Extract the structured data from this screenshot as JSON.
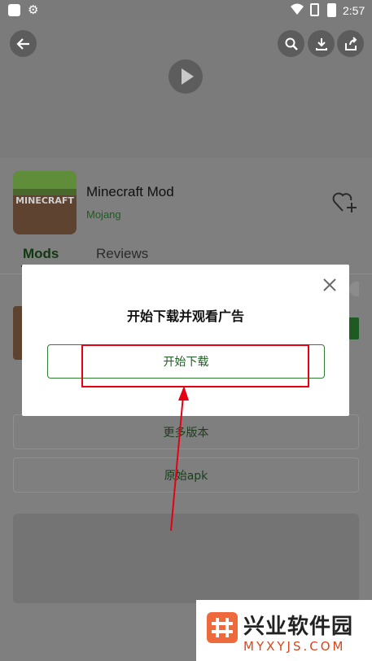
{
  "status_bar": {
    "time": "2:57"
  },
  "header": {
    "icons": [
      "back-arrow-icon",
      "play-icon",
      "search-icon",
      "download-icon",
      "share-icon"
    ]
  },
  "app": {
    "name": "Minecraft Mod",
    "developer": "Mojang",
    "icon_text": "MINECRAFT"
  },
  "tabs": [
    {
      "label": "Mods",
      "active": true
    },
    {
      "label": "Reviews",
      "active": false
    }
  ],
  "buttons": {
    "more_versions": "更多版本",
    "original_apk": "原始apk"
  },
  "dialog": {
    "title": "开始下载并观看广告",
    "start_label": "开始下载"
  },
  "watermark": {
    "name": "兴业软件园",
    "domain": "MYXYJS.COM"
  },
  "colors": {
    "accent": "#2e7d32",
    "overlay": "#7f7f7f",
    "highlight": "#e60012"
  }
}
